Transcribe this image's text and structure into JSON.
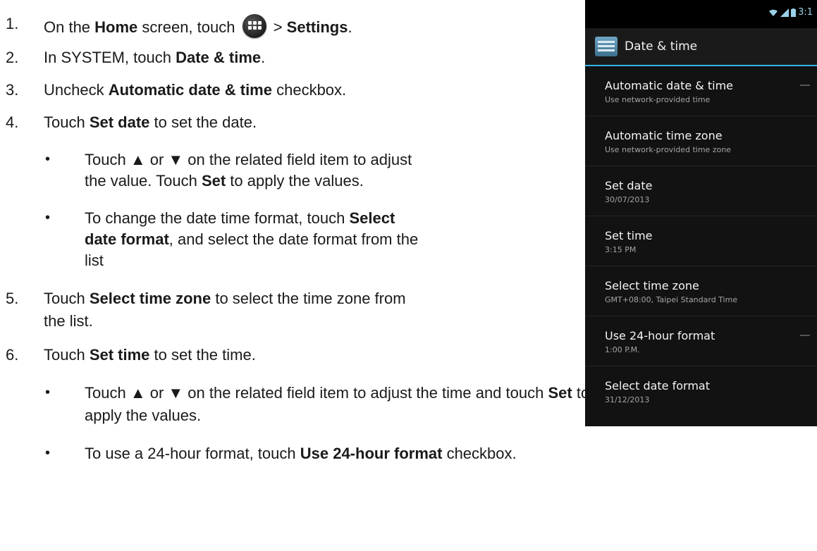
{
  "steps": [
    {
      "number": "1.",
      "parts": [
        "On the ",
        "Home",
        " screen, touch ",
        " > ",
        "Settings",
        "."
      ]
    },
    {
      "number": "2.",
      "parts": [
        "In SYSTEM, touch ",
        "Date & time",
        "."
      ]
    },
    {
      "number": "3.",
      "parts": [
        "Uncheck ",
        "Automatic date & time",
        " checkbox."
      ]
    },
    {
      "number": "4.",
      "parts": [
        "Touch ",
        "Set date",
        " to set the date."
      ]
    },
    {
      "number": "5.",
      "lines": [
        [
          "Touch ",
          "Select time zone",
          " to select the time zone from"
        ],
        [
          "the list."
        ]
      ]
    },
    {
      "number": "6.",
      "parts": [
        "Touch ",
        "Set time",
        " to set the time."
      ]
    }
  ],
  "bullets_step4": [
    {
      "lines": [
        [
          "Touch ▲ or ▼ on the related field item to adjust"
        ],
        [
          "the value. Touch ",
          "Set",
          " to apply the values."
        ]
      ]
    },
    {
      "lines": [
        [
          "To change the date time format, touch ",
          "Select"
        ],
        [
          "date format",
          ", and select the date format from the"
        ],
        [
          "list"
        ]
      ]
    }
  ],
  "bullets_step6": [
    {
      "lines": [
        [
          "Touch ▲ or ▼ on the related field item to adjust the time and touch ",
          "Set",
          " to"
        ],
        [
          "apply the values."
        ]
      ]
    },
    {
      "lines": [
        [
          "To use a 24-hour format, touch ",
          "Use 24-hour format",
          " checkbox."
        ]
      ]
    }
  ],
  "bullet_glyph": "•",
  "icons": {
    "apps": "apps-grid-icon",
    "settings": "settings-icon",
    "wifi": "wifi-icon",
    "signal": "signal-icon",
    "battery": "battery-icon"
  },
  "phone": {
    "status_time": "3:1",
    "title": "Date & time",
    "accent_color": "#33b5e5",
    "prefs": [
      {
        "title": "Automatic date & time",
        "summary": "Use network-provided time",
        "checkbox": true
      },
      {
        "title": "Automatic time zone",
        "summary": "Use network-provided time zone",
        "checkbox": false
      },
      {
        "title": "Set date",
        "summary": "30/07/2013",
        "checkbox": false
      },
      {
        "title": "Set time",
        "summary": "3:15 PM",
        "checkbox": false
      },
      {
        "title": "Select time zone",
        "summary": "GMT+08:00, Taipei Standard Time",
        "checkbox": false
      },
      {
        "title": "Use 24-hour format",
        "summary": "1:00 P.M.",
        "checkbox": true
      },
      {
        "title": "Select date format",
        "summary": "31/12/2013",
        "checkbox": false
      }
    ]
  }
}
